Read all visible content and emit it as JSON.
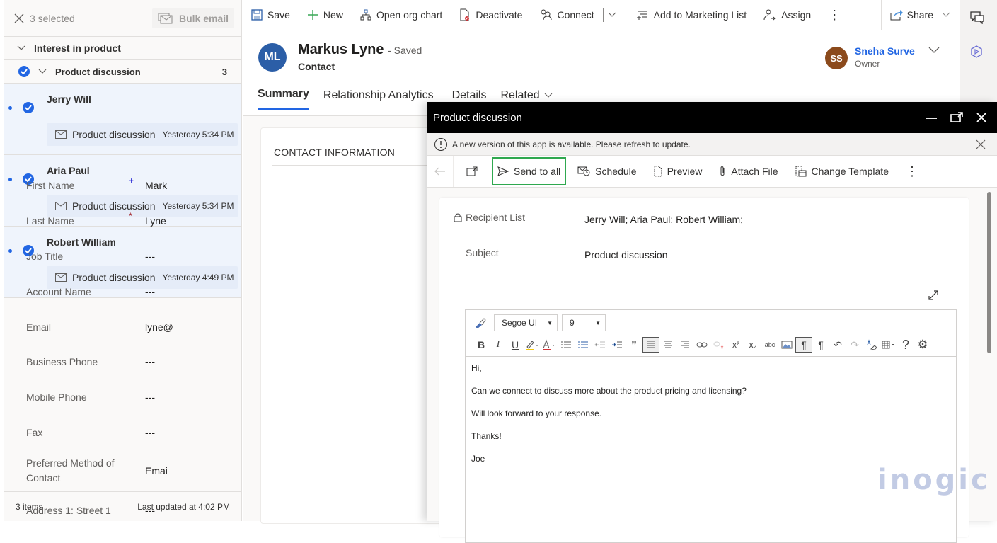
{
  "left_panel": {
    "selected_text": "3 selected",
    "bulk_email_label": "Bulk email",
    "group_label": "Interest in product",
    "subgroup_label": "Product discussion",
    "subgroup_count": "3",
    "items": [
      {
        "name": "Jerry Will",
        "activity": "Product discussion",
        "time": "Yesterday 5:34 PM"
      },
      {
        "name": "Aria Paul",
        "activity": "Product discussion",
        "time": "Yesterday 5:34 PM"
      },
      {
        "name": "Robert William",
        "activity": "Product discussion",
        "time": "Yesterday 4:49 PM"
      }
    ],
    "footer_count": "3 items",
    "footer_updated": "Last updated at 4:02 PM"
  },
  "command_bar": {
    "save": "Save",
    "new": "New",
    "open_org_chart": "Open org chart",
    "deactivate": "Deactivate",
    "connect": "Connect",
    "add_to_marketing_list": "Add to Marketing List",
    "assign": "Assign",
    "more": "⋮",
    "share": "Share"
  },
  "record": {
    "initials": "ML",
    "name": "Markus Lyne",
    "status": "- Saved",
    "type": "Contact",
    "owner_initials": "SS",
    "owner_name": "Sneha Surve",
    "owner_role": "Owner",
    "tabs": [
      "Summary",
      "Relationship Analytics",
      "Details",
      "Related"
    ]
  },
  "contact_info": {
    "title": "CONTACT INFORMATION",
    "fields": [
      {
        "label": "First Name",
        "req": "+",
        "value": "Mark"
      },
      {
        "label": "Last Name",
        "req": "*",
        "value": "Lyne"
      },
      {
        "label": "Job Title",
        "req": "",
        "value": "---"
      },
      {
        "label": "Account Name",
        "req": "",
        "value": "---"
      },
      {
        "label": "Email",
        "req": "",
        "value": "lyne@"
      },
      {
        "label": "Business Phone",
        "req": "",
        "value": "---"
      },
      {
        "label": "Mobile Phone",
        "req": "",
        "value": "---"
      },
      {
        "label": "Fax",
        "req": "",
        "value": "---"
      },
      {
        "label": "Preferred Method of Contact",
        "req": "",
        "value": "Emai"
      },
      {
        "label": "Address 1: Street 1",
        "req": "",
        "value": "---"
      }
    ]
  },
  "dialog": {
    "title": "Product discussion",
    "notice": "A new version of this app is available. Please refresh to update.",
    "toolbar": {
      "send_to_all": "Send to all",
      "schedule": "Schedule",
      "preview": "Preview",
      "attach_file": "Attach File",
      "change_template": "Change Template",
      "more": "⋮"
    },
    "recipient_label": "Recipient List",
    "recipient_value": "Jerry Will; Aria Paul; Robert William;",
    "subject_label": "Subject",
    "subject_value": "Product discussion",
    "editor": {
      "font": "Segoe UI",
      "size": "9",
      "body": [
        "Hi,",
        "Can we connect to discuss more about the product pricing and licensing?",
        "Will look forward to your response.",
        "Thanks!",
        "Joe"
      ]
    }
  },
  "watermark": "inogic",
  "colors": {
    "accent": "#2266e3",
    "send_highlight": "#2fa84f",
    "dialog_title_bg": "#000000"
  }
}
